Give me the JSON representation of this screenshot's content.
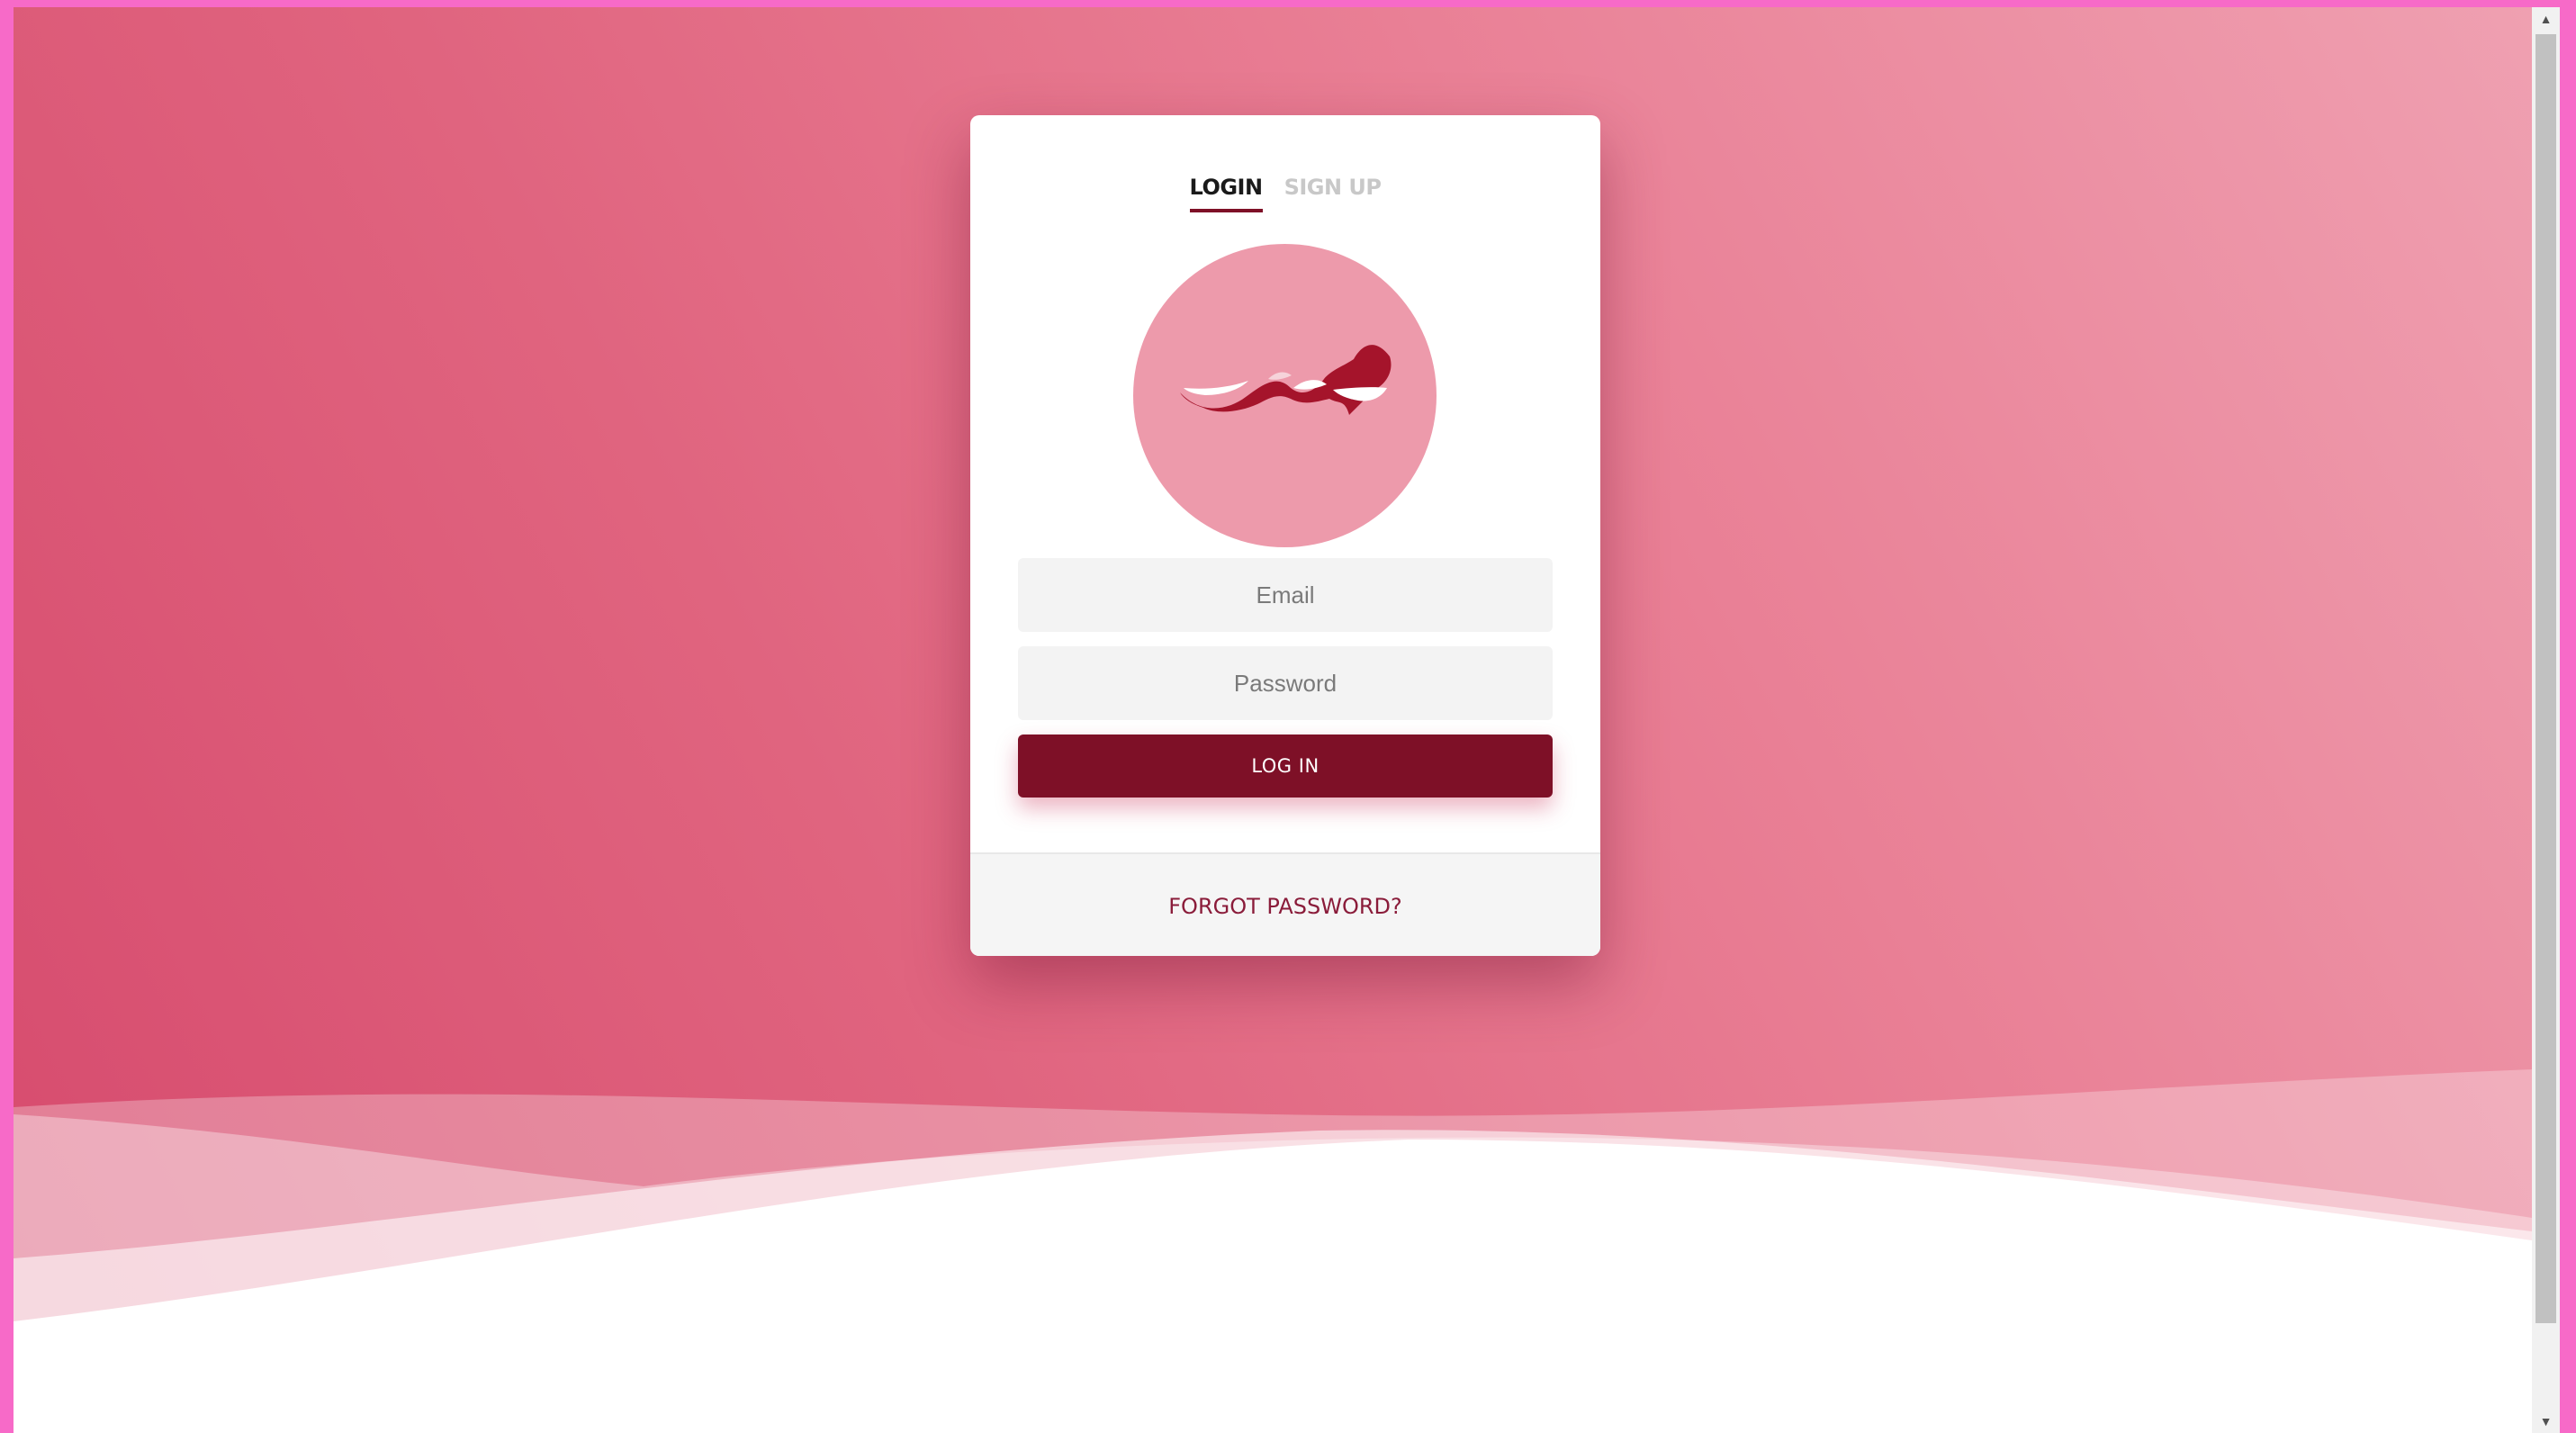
{
  "tabs": {
    "login": "LOGIN",
    "signup": "SIGN UP"
  },
  "form": {
    "email_placeholder": "Email",
    "password_placeholder": "Password",
    "submit_label": "LOG IN"
  },
  "footer": {
    "forgot_password": "FORGOT PASSWORD?"
  },
  "colors": {
    "brand": "#7e1027",
    "background_start": "#d64a6d",
    "background_end": "#efa0b1",
    "logo_circle": "#ed9aab",
    "page_frame": "#f76ac8"
  },
  "icons": {
    "logo": "ribbon-wave-logo",
    "scroll_up": "scroll-up-arrow-icon",
    "scroll_down": "scroll-down-arrow-icon"
  },
  "active_tab": "login"
}
